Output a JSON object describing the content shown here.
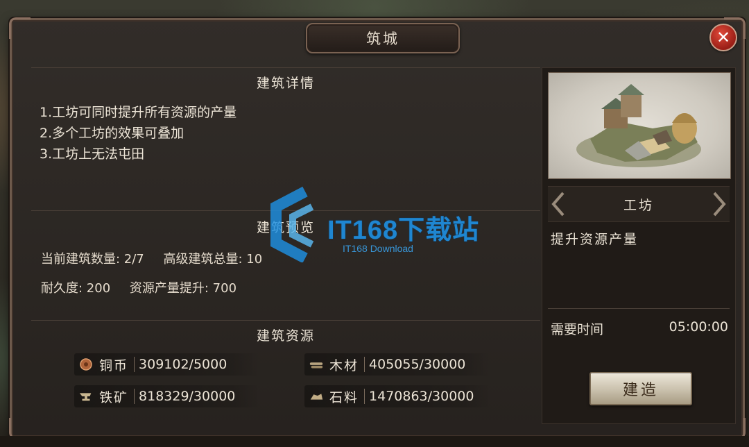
{
  "dialog": {
    "title": "筑城",
    "close_icon": "close-icon"
  },
  "details": {
    "title": "建筑详情",
    "lines": [
      "1.工坊可同时提升所有资源的产量",
      "2.多个工坊的效果可叠加",
      "3.工坊上无法屯田"
    ]
  },
  "overview": {
    "title": "建筑预览",
    "row1_a": "当前建筑数量: 2/7",
    "row1_b": "高级建筑总量: 10",
    "row2_a": "耐久度: 200",
    "row2_b": "资源产量提升: 700"
  },
  "resources": {
    "title": "建筑资源",
    "items": [
      {
        "icon": "copper-coin-icon",
        "label": "铜币",
        "value": "309102/5000"
      },
      {
        "icon": "wood-icon",
        "label": "木材",
        "value": "405055/30000"
      },
      {
        "icon": "iron-anvil-icon",
        "label": "铁矿",
        "value": "818329/30000"
      },
      {
        "icon": "stone-icon",
        "label": "石料",
        "value": "1470863/30000"
      }
    ]
  },
  "building": {
    "name": "工坊",
    "effect": "提升资源产量",
    "time_label": "需要时间",
    "time_value": "05:00:00",
    "build_label": "建造"
  },
  "watermark": {
    "text": "IT168下载站",
    "sub": "IT168 Download"
  },
  "colors": {
    "panel_bg": "#2b2622",
    "border": "#6e5a4c",
    "text": "#ece4d6",
    "close_red": "#c0281e"
  }
}
